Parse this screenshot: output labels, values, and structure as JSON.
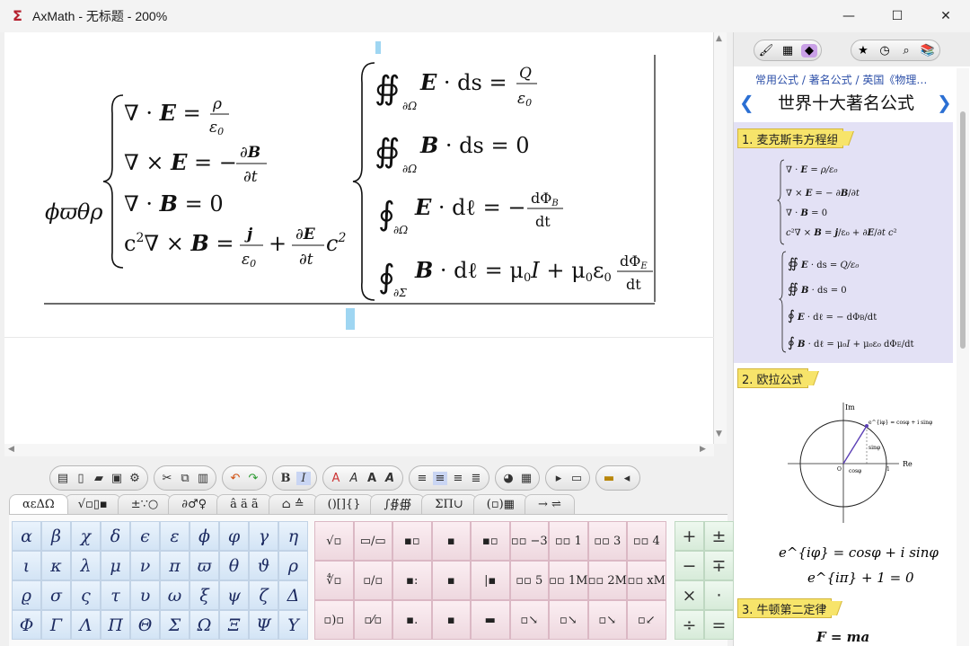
{
  "window": {
    "title": "AxMath - 无标题 - 200%",
    "controls": {
      "minimize": "—",
      "maximize": "☐",
      "close": "✕"
    }
  },
  "editor": {
    "lhs": "ϕϖθρ",
    "left_system": [
      "∇·E = ρ/ε₀",
      "∇×E = −∂B/∂t",
      "∇·B = 0",
      "c²∇×B = j/ε₀ + ∂E/∂t c²"
    ],
    "right_system": [
      "∯∂Ω E·ds = Q/ε₀",
      "∯∂Ω B·ds = 0",
      "∮∂Ω E·dℓ = −dΦB/dt",
      "∮∂Σ B·dℓ = μ₀I + μ₀ε₀ dΦE/dt"
    ]
  },
  "right_panel": {
    "breadcrumb": "常用公式 / 著名公式 / 英国《物理…",
    "title": "世界十大著名公式",
    "nav_prev": "❮",
    "nav_next": "❯",
    "sections": [
      {
        "label": "1. 麦克斯韦方程组"
      },
      {
        "label": "2. 欧拉公式",
        "formula_1": "e^{iφ} = cosφ + i sinφ",
        "formula_2": "e^{iπ} + 1 = 0"
      },
      {
        "label": "3. 牛顿第二定律",
        "formula_1": "F = ma"
      }
    ],
    "euler_diagram": {
      "axis_re": "Re",
      "axis_im": "Im",
      "point": "e^{iφ} = cosφ + i sinφ",
      "sin": "sinφ",
      "cos": "cosφ",
      "origin": "O",
      "one": "1"
    }
  },
  "symbol_tabs": [
    "αεΔΩ",
    "√▫▯▪",
    "±∵○",
    "∂♂♀",
    "â ä ã",
    "⌂ ≙",
    "()[]{}",
    "∫∯∰",
    "ΣΠ∪",
    "(▫)▦",
    "→ ⇌"
  ],
  "greek_letters": [
    "α",
    "β",
    "χ",
    "δ",
    "ϵ",
    "ε",
    "ϕ",
    "φ",
    "γ",
    "η",
    "ι",
    "κ",
    "λ",
    "μ",
    "ν",
    "π",
    "ϖ",
    "θ",
    "ϑ",
    "ρ",
    "ϱ",
    "σ",
    "ς",
    "τ",
    "υ",
    "ω",
    "ξ",
    "ψ",
    "ζ",
    "Δ",
    "Φ",
    "Γ",
    "Λ",
    "Π",
    "Θ",
    "Σ",
    "Ω",
    "Ξ",
    "Ψ",
    "Υ"
  ],
  "templates": [
    "√▫",
    "▭/▭",
    "▪▫",
    "▪",
    "▪▫",
    "▫▫ −3",
    "▫▫ 1",
    "▫▫ 3",
    "▫▫ 4",
    "∜▫",
    "▫/▫",
    "▪:",
    "▪",
    "|▪",
    "▫▫ 5",
    "▫▫ 1M",
    "▫▫ 2M",
    "▫▫ xM",
    "▫)▫",
    "▫⁄▫",
    "▪.",
    "▪",
    "▬",
    "▫↘",
    "▫↘",
    "▫↘",
    "▫↙"
  ],
  "ops": [
    "+",
    "±",
    "−",
    "∓",
    "×",
    "·",
    "÷",
    "="
  ]
}
